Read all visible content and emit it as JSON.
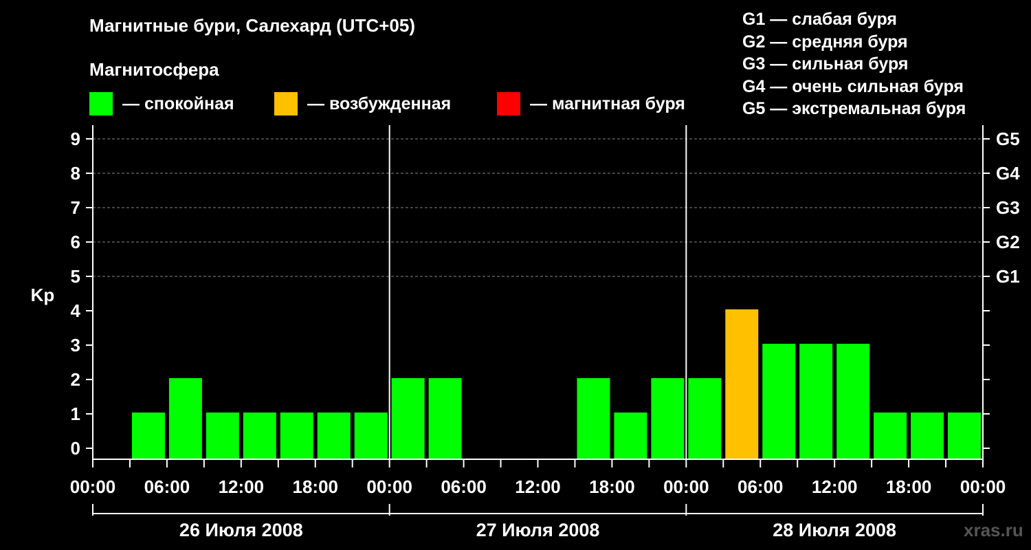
{
  "header": {
    "title": "Магнитные бури, Салехард (UTC+05)",
    "subtitle": "Магнитосфера"
  },
  "legend": [
    {
      "label": "— спокойная",
      "color": "#00ff00"
    },
    {
      "label": "— возбужденная",
      "color": "#ffc000"
    },
    {
      "label": "— магнитная буря",
      "color": "#ff0000"
    }
  ],
  "storm_legend": [
    "G1 — слабая буря",
    "G2 — средняя буря",
    "G3 — сильная буря",
    "G4 — очень сильная буря",
    "G5 — экстремальная буря"
  ],
  "watermark": "xras.ru",
  "chart_data": {
    "type": "bar",
    "ylabel": "Kp",
    "ylim": [
      0,
      9
    ],
    "y_ticks": [
      "0",
      "1",
      "2",
      "3",
      "4",
      "5",
      "6",
      "7",
      "8",
      "9"
    ],
    "right_ticks": [
      {
        "value": 5,
        "label": "G1"
      },
      {
        "value": 6,
        "label": "G2"
      },
      {
        "value": 7,
        "label": "G3"
      },
      {
        "value": 8,
        "label": "G4"
      },
      {
        "value": 9,
        "label": "G5"
      }
    ],
    "x_ticks": [
      "00:00",
      "06:00",
      "12:00",
      "18:00",
      "00:00",
      "06:00",
      "12:00",
      "18:00",
      "00:00",
      "06:00",
      "12:00",
      "18:00",
      "00:00"
    ],
    "days": [
      "26 Июля 2008",
      "27 Июля 2008",
      "28 Июля 2008"
    ],
    "grid": "dashed horizontal at Kp 5-9",
    "colors": {
      "quiet": "#00ff00",
      "active": "#ffc000",
      "storm": "#ff0000"
    },
    "bars": [
      {
        "start_hour": 0,
        "value": null
      },
      {
        "start_hour": 3,
        "value": 1
      },
      {
        "start_hour": 6,
        "value": 2
      },
      {
        "start_hour": 9,
        "value": 1
      },
      {
        "start_hour": 12,
        "value": 1
      },
      {
        "start_hour": 15,
        "value": 1
      },
      {
        "start_hour": 18,
        "value": 1
      },
      {
        "start_hour": 21,
        "value": 1
      },
      {
        "start_hour": 24,
        "value": 2
      },
      {
        "start_hour": 27,
        "value": 2
      },
      {
        "start_hour": 30,
        "value": null
      },
      {
        "start_hour": 33,
        "value": null
      },
      {
        "start_hour": 36,
        "value": null
      },
      {
        "start_hour": 39,
        "value": 2
      },
      {
        "start_hour": 42,
        "value": 1
      },
      {
        "start_hour": 45,
        "value": 2
      },
      {
        "start_hour": 48,
        "value": 2
      },
      {
        "start_hour": 51,
        "value": 4
      },
      {
        "start_hour": 54,
        "value": 3
      },
      {
        "start_hour": 57,
        "value": 3
      },
      {
        "start_hour": 60,
        "value": 3
      },
      {
        "start_hour": 63,
        "value": 1
      },
      {
        "start_hour": 66,
        "value": 1
      },
      {
        "start_hour": 69,
        "value": 1
      }
    ]
  }
}
